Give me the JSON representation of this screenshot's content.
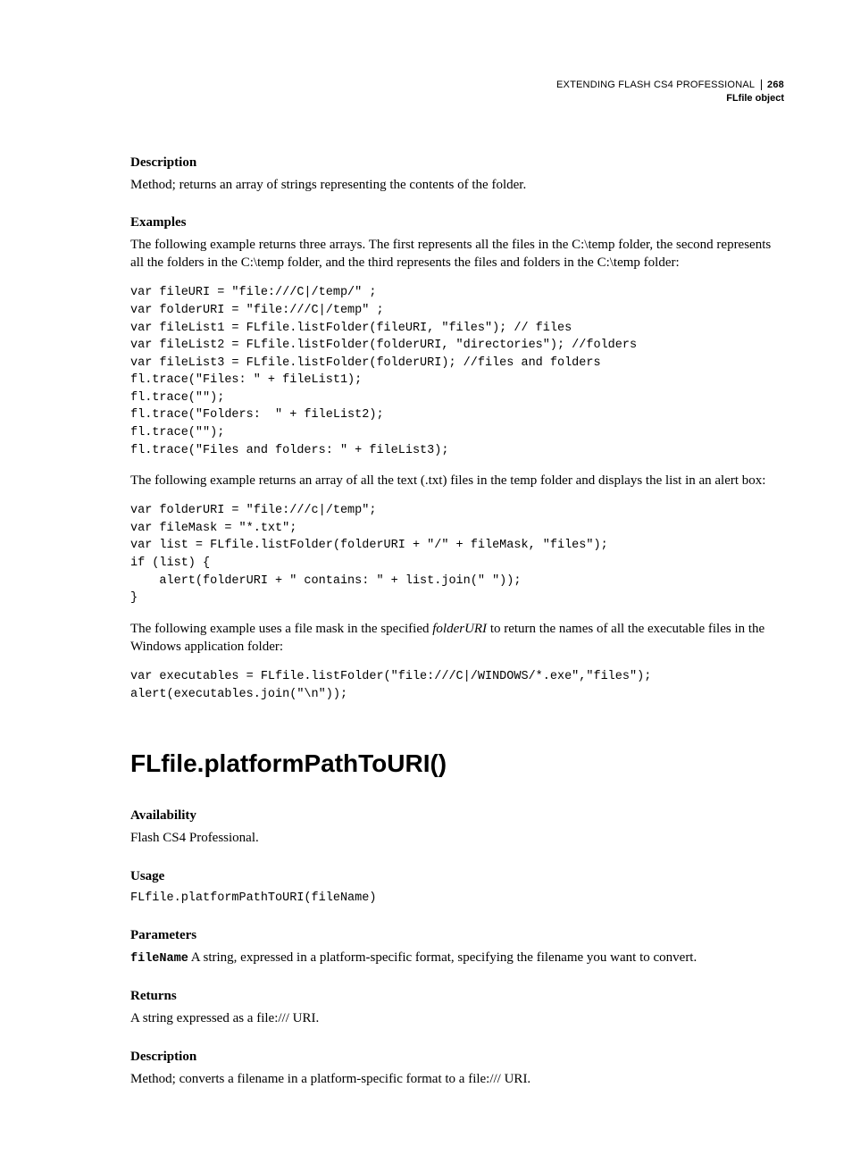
{
  "header": {
    "doc_title": "EXTENDING FLASH CS4 PROFESSIONAL",
    "page_number": "268",
    "section": "FLfile object"
  },
  "sec1": {
    "heading": "Description",
    "text": "Method; returns an array of strings representing the contents of the folder."
  },
  "sec2": {
    "heading": "Examples",
    "intro1": "The following example returns three arrays. The first represents all the files in the C:\\temp folder, the second represents all the folders in the C:\\temp folder, and the third represents the files and folders in the C:\\temp folder:",
    "code1": "var fileURI = \"file:///C|/temp/\" ;\nvar folderURI = \"file:///C|/temp\" ;\nvar fileList1 = FLfile.listFolder(fileURI, \"files\"); // files\nvar fileList2 = FLfile.listFolder(folderURI, \"directories\"); //folders\nvar fileList3 = FLfile.listFolder(folderURI); //files and folders\nfl.trace(\"Files: \" + fileList1);\nfl.trace(\"\");\nfl.trace(\"Folders:  \" + fileList2);\nfl.trace(\"\");\nfl.trace(\"Files and folders: \" + fileList3);",
    "intro2": "The following example returns an array of all the text (.txt) files in the temp folder and displays the list in an alert box:",
    "code2": "var folderURI = \"file:///c|/temp\";\nvar fileMask = \"*.txt\";\nvar list = FLfile.listFolder(folderURI + \"/\" + fileMask, \"files\");\nif (list) {\n    alert(folderURI + \" contains: \" + list.join(\" \"));\n}",
    "intro3_a": "The following example uses a file mask in the specified ",
    "intro3_i": "folderURI",
    "intro3_b": " to return the names of all the executable files in the Windows application folder:",
    "code3": "var executables = FLfile.listFolder(\"file:///C|/WINDOWS/*.exe\",\"files\");\nalert(executables.join(\"\\n\"));"
  },
  "method": {
    "title": "FLfile.platformPathToURI()"
  },
  "avail": {
    "heading": "Availability",
    "text": "Flash CS4 Professional."
  },
  "usage": {
    "heading": "Usage",
    "code": "FLfile.platformPathToURI(fileName)"
  },
  "params": {
    "heading": "Parameters",
    "name": "fileName",
    "text": "  A string, expressed in a platform-specific format, specifying the filename you want to convert."
  },
  "returns": {
    "heading": "Returns",
    "text": "A string expressed as a file:/// URI."
  },
  "desc2": {
    "heading": "Description",
    "text": "Method; converts a filename in a platform-specific format to a file:/// URI."
  }
}
